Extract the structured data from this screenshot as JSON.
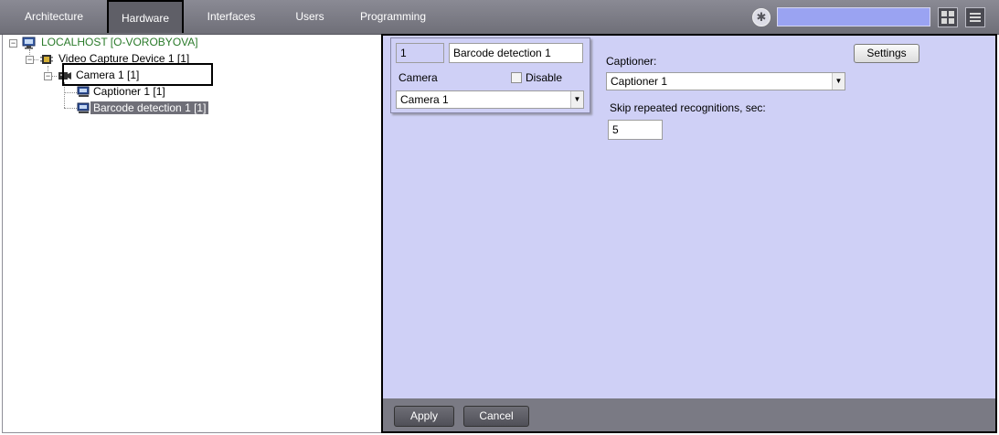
{
  "topbar": {
    "tabs": [
      "Architecture",
      "Hardware",
      "Interfaces",
      "Users",
      "Programming"
    ],
    "active_tab": "Hardware",
    "search_value": ""
  },
  "tree": {
    "root": "LOCALHOST [O-VOROBYOVA]",
    "device": "Video Capture Device 1 [1]",
    "camera": "Camera 1 [1]",
    "captioner": "Captioner 1 [1]",
    "barcode": "Barcode detection 1 [1]"
  },
  "form": {
    "id_value": "1",
    "name_value": "Barcode detection 1",
    "camera_label": "Camera",
    "disable_label": "Disable",
    "camera_value": "Camera 1",
    "captioner_label": "Captioner:",
    "captioner_value": "Captioner 1",
    "skip_label": "Skip repeated recognitions, sec:",
    "skip_value": "5",
    "settings_label": "Settings"
  },
  "footer": {
    "apply_label": "Apply",
    "cancel_label": "Cancel"
  }
}
